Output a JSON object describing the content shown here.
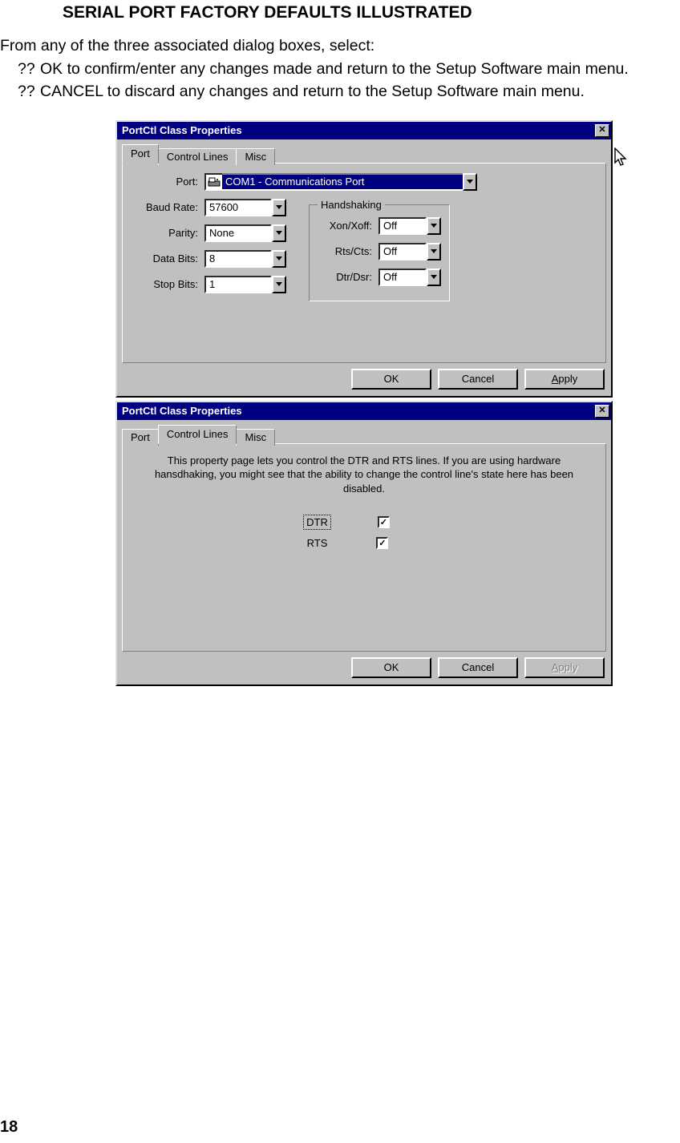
{
  "heading": "SERIAL PORT FACTORY DEFAULTS ILLUSTRATED",
  "intro": "From any of the three associated dialog boxes, select:",
  "bullets": {
    "marker": "??",
    "items": [
      "OK to confirm/enter any changes made and return to the Setup Software main menu.",
      "CANCEL to discard any changes and return to the Setup Software main menu."
    ]
  },
  "dialog1": {
    "title": "PortCtl Class Properties",
    "tabs": {
      "active": "Port",
      "others": [
        "Control Lines",
        "Misc"
      ]
    },
    "fields": {
      "port_label": "Port:",
      "port_value": "COM1 - Communications Port",
      "baud_label": "Baud Rate:",
      "baud_value": "57600",
      "parity_label": "Parity:",
      "parity_value": "None",
      "databits_label": "Data Bits:",
      "databits_value": "8",
      "stopbits_label": "Stop Bits:",
      "stopbits_value": "1"
    },
    "handshaking": {
      "legend": "Handshaking",
      "xon_label": "Xon/Xoff:",
      "xon_value": "Off",
      "rts_label": "Rts/Cts:",
      "rts_value": "Off",
      "dtr_label": "Dtr/Dsr:",
      "dtr_value": "Off"
    },
    "buttons": {
      "ok": "OK",
      "cancel": "Cancel",
      "apply_prefix": "A",
      "apply_rest": "pply"
    }
  },
  "dialog2": {
    "title": "PortCtl Class Properties",
    "tabs": {
      "active": "Control Lines",
      "others": [
        "Port",
        "Misc"
      ]
    },
    "description": "This property page lets you control the DTR and RTS lines. If you are using hardware hansdhaking, you might see that the ability to change the control line's state here has been disabled.",
    "checks": {
      "dtr_label": "DTR",
      "dtr_checked": "✓",
      "rts_label": "RTS",
      "rts_checked": "✓"
    },
    "buttons": {
      "ok": "OK",
      "cancel": "Cancel",
      "apply_prefix": "A",
      "apply_rest": "pply"
    }
  },
  "page_number": "18"
}
